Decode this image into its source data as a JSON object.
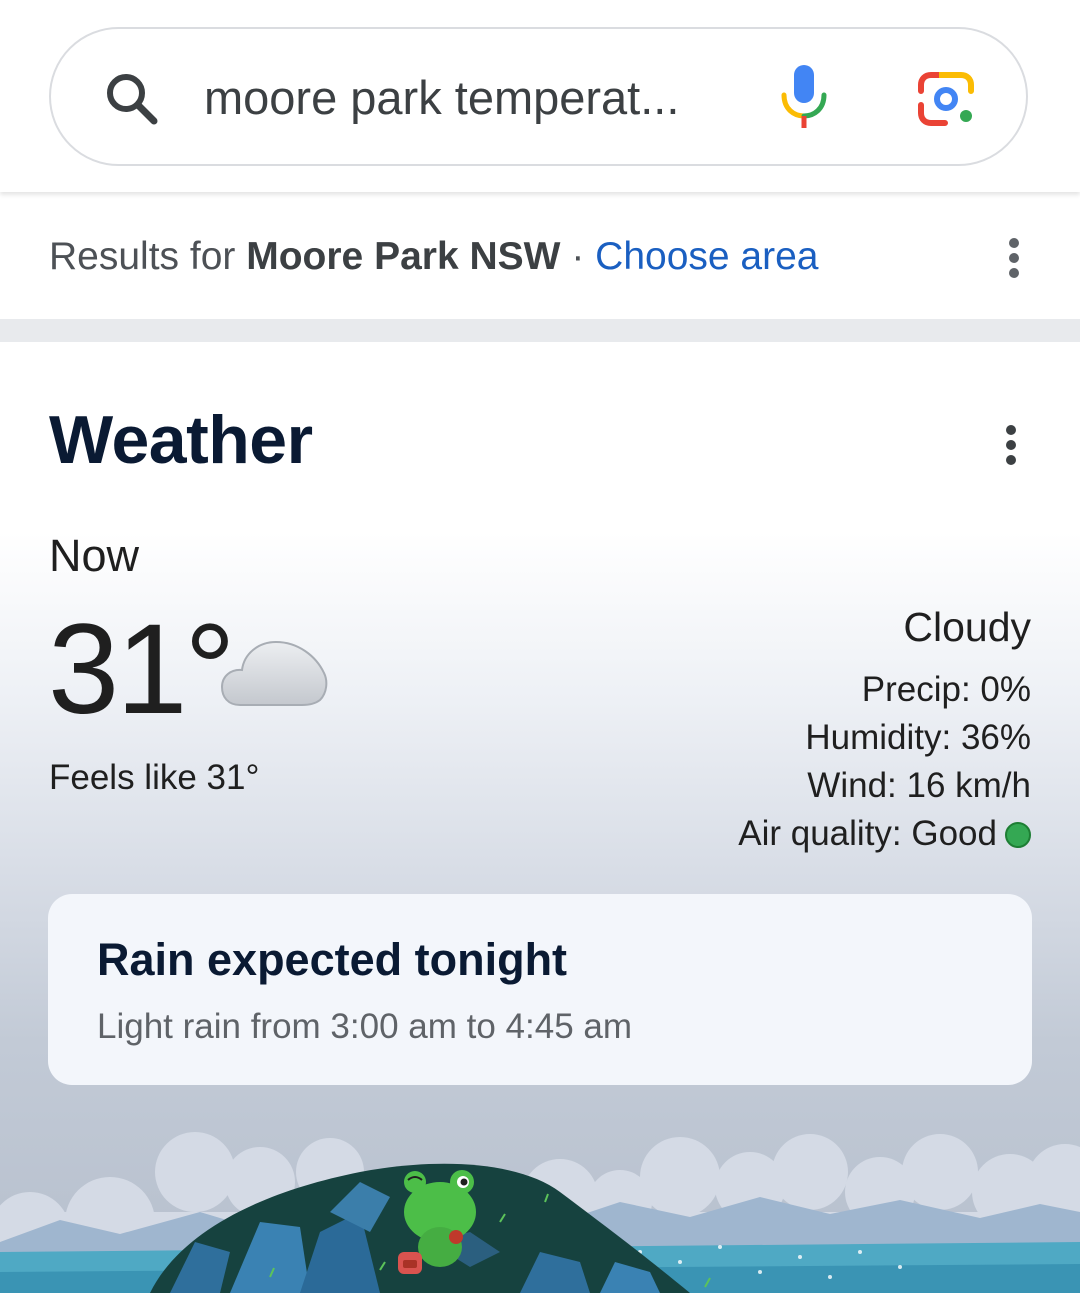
{
  "search": {
    "query": "moore park temperat..."
  },
  "results": {
    "prefix": "Results for",
    "location": "Moore Park NSW",
    "separator": "·",
    "choose_area": "Choose area"
  },
  "weather": {
    "title": "Weather",
    "now_label": "Now",
    "temperature": "31°",
    "feels_like": "Feels like 31°",
    "condition": "Cloudy",
    "condition_icon": "cloud-icon",
    "precip": "Precip: 0%",
    "humidity": "Humidity: 36%",
    "wind": "Wind: 16 km/h",
    "air_quality": "Air quality: Good",
    "air_quality_color": "#34a853"
  },
  "alert": {
    "title": "Rain expected tonight",
    "subtitle": "Light rain from 3:00 am to 4:45 am"
  },
  "colors": {
    "link_blue": "#1a5fc1",
    "title_navy": "#0a1a33",
    "google_blue": "#4285f4",
    "google_red": "#ea4335",
    "google_yellow": "#fbbc04",
    "google_green": "#34a853"
  }
}
